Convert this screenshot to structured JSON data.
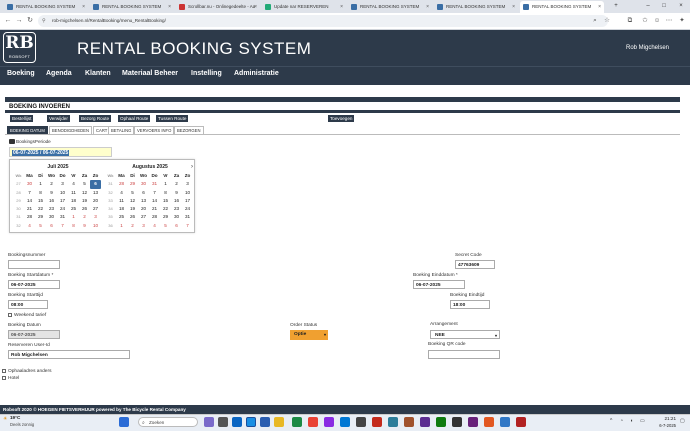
{
  "browser": {
    "tabs": [
      "RENTAL BOOKING SYSTEM",
      "RENTAL BOOKING SYSTEM",
      "Scrollbar.nu - Onlinegedeelte - Aa",
      "Update nar RESERVEREN",
      "RENTAL BOOKING SYSTEM",
      "RENTAL BOOKING SYSTEM",
      "RENTAL BOOKING SYSTEM"
    ],
    "url": "rob-migchelsen.nl/RentalBooking/menu_RentalBooking/"
  },
  "app": {
    "logo_text": "RB",
    "logo_sub": "ROBSOFT",
    "title": "RENTAL BOOKING SYSTEM",
    "user": "Rob Migchelsen"
  },
  "nav": [
    "Boeking",
    "Agenda",
    "Klanten",
    "Materiaal Beheer",
    "Instelling",
    "Administratie"
  ],
  "page": {
    "title": "BOEKING INVOEREN",
    "buttons": {
      "bestellijst": "Bestellijst",
      "verwijder": "Verwijder",
      "bezorg_route": "Bezorg Route",
      "ophaal_route": "Ophaal Route",
      "tussen_route": "Tussen Route",
      "toevoegen": "Toevoegen"
    },
    "tabs": [
      "BOEKING DATUM",
      "BENODIGDHEDEN",
      "CART",
      "BETALING",
      "VERVOERS INFO",
      "BEZORGEN"
    ]
  },
  "period": {
    "label": "BookingsPeriode",
    "value": "06-07-2025 / 06-07-2025"
  },
  "calendar": {
    "headers": [
      "Wk",
      "Ma",
      "Di",
      "Wo",
      "Do",
      "Vr",
      "Za",
      "Zo"
    ],
    "months": [
      {
        "title": "Juli 2025",
        "rows": [
          [
            "27",
            "30",
            "1",
            "2",
            "3",
            "4",
            "5",
            "6"
          ],
          [
            "28",
            "7",
            "8",
            "9",
            "10",
            "11",
            "12",
            "13"
          ],
          [
            "29",
            "14",
            "15",
            "16",
            "17",
            "18",
            "19",
            "20"
          ],
          [
            "30",
            "21",
            "22",
            "23",
            "24",
            "25",
            "26",
            "27"
          ],
          [
            "31",
            "28",
            "29",
            "30",
            "31",
            "1",
            "2",
            "3"
          ],
          [
            "32",
            "4",
            "5",
            "6",
            "7",
            "8",
            "9",
            "10"
          ]
        ]
      },
      {
        "title": "Augustus 2025",
        "rows": [
          [
            "31",
            "28",
            "29",
            "30",
            "31",
            "1",
            "2",
            "3"
          ],
          [
            "32",
            "4",
            "5",
            "6",
            "7",
            "8",
            "9",
            "10"
          ],
          [
            "33",
            "11",
            "12",
            "13",
            "14",
            "15",
            "16",
            "17"
          ],
          [
            "34",
            "18",
            "19",
            "20",
            "21",
            "22",
            "23",
            "24"
          ],
          [
            "35",
            "25",
            "26",
            "27",
            "28",
            "29",
            "30",
            "31"
          ],
          [
            "36",
            "1",
            "2",
            "3",
            "4",
            "5",
            "6",
            "7"
          ]
        ]
      }
    ],
    "selected_day": "6"
  },
  "form": {
    "bookingsnummer_label": "Bookingsnummer",
    "bookingsnummer_value": "",
    "secret_code_label": "Secret Code",
    "secret_code_value": "47763609",
    "start_datum_label": "Boeking Startdatum *",
    "start_datum_value": "06-07-2025",
    "eind_datum_label": "Boeking Einddatum *",
    "eind_datum_value": "06-07-2025",
    "start_tijd_label": "Boeking Starttijd",
    "start_tijd_value": "08:00",
    "eind_tijd_label": "Boeking Eindtijd",
    "eind_tijd_value": "18:00",
    "weekend_label": "Weekend tarief",
    "boeking_datum_label": "Boeking Datum",
    "boeking_datum_value": "06-07-2025",
    "order_status_label": "Order Status",
    "order_status_value": "Optie",
    "arrangement_label": "Arrangement",
    "arrangement_value": "NEE",
    "reserveren_user_label": "Reserveren User-Id",
    "reserveren_user_value": "Rob Migchelsen",
    "qr_label": "Boeking QR code",
    "ophaal_label": "Ophaaladres anders",
    "hotel_label": "Hotel"
  },
  "footer": "Robsoft 2020 © HOEGEN FIETSVERHUUR powered by The Bicycle Rental Company",
  "taskbar": {
    "weather_temp": "19°C",
    "weather_desc": "Deels zonnig",
    "search": "Zoeken",
    "time": "21:21",
    "date": "6-7-2025"
  },
  "colors": {
    "header": "#2d3a4a",
    "accent": "#3a6ea5",
    "status": "#f0a030",
    "highlight": "#ffffcc"
  }
}
